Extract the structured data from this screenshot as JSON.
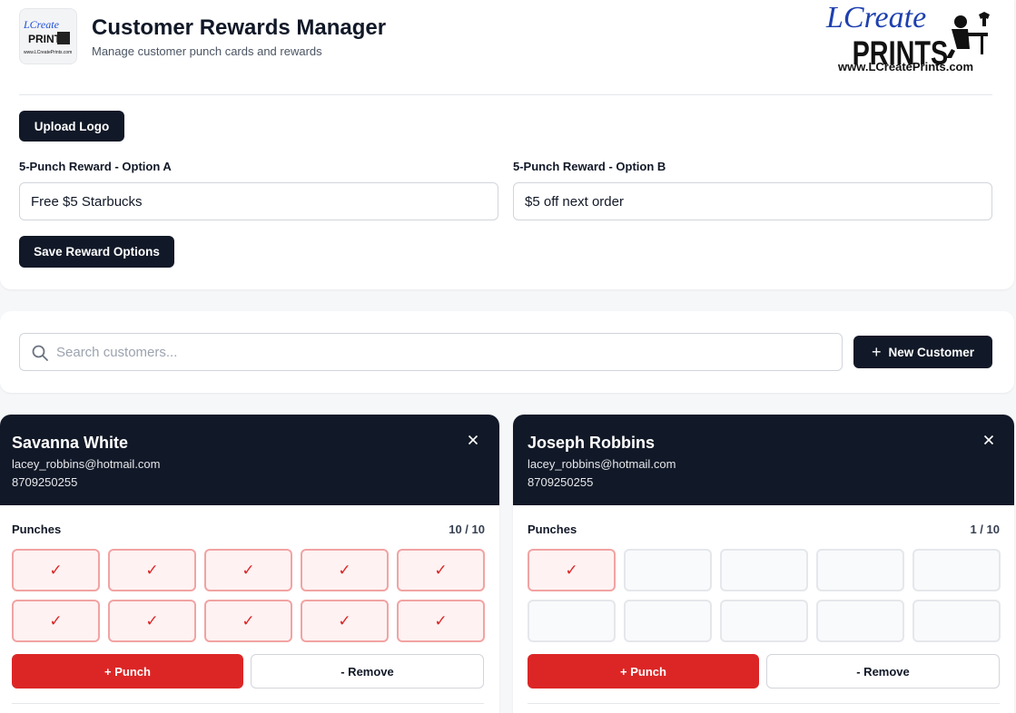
{
  "header": {
    "title": "Customer Rewards Manager",
    "subtitle": "Manage customer punch cards and rewards",
    "logo_text_script": "LCreate",
    "logo_text_block": "PRINTS",
    "logo_url": "www.LCreatePrints.com"
  },
  "settings": {
    "upload_label": "Upload Logo",
    "option_a": {
      "label": "5-Punch Reward - Option A",
      "value": "Free $5 Starbucks"
    },
    "option_b": {
      "label": "5-Punch Reward - Option B",
      "value": "$5 off next order"
    },
    "save_label": "Save Reward Options"
  },
  "search": {
    "placeholder": "Search customers...",
    "new_label": "New Customer"
  },
  "customers": [
    {
      "name": "Savanna White",
      "email": "lacey_robbins@hotmail.com",
      "phone": "8709250255",
      "punches_label": "Punches",
      "count_text": "10 / 10",
      "punched": 10,
      "total": 10,
      "punch_label": "+ Punch",
      "remove_label": "- Remove"
    },
    {
      "name": "Joseph Robbins",
      "email": "lacey_robbins@hotmail.com",
      "phone": "8709250255",
      "punches_label": "Punches",
      "count_text": "1 / 10",
      "punched": 1,
      "total": 10,
      "punch_label": "+ Punch",
      "remove_label": "- Remove"
    }
  ],
  "theme": {
    "dark": "#111827",
    "red": "#dc2626",
    "check": "✓"
  }
}
